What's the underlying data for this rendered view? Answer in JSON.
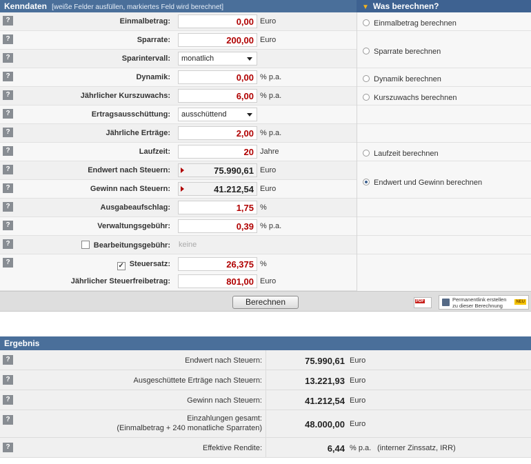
{
  "header": {
    "title": "Kenndaten",
    "subtitle": "[weiße Felder ausfüllen, markiertes Feld wird berechnet]",
    "right_title": "Was berechnen?"
  },
  "help_label": "?",
  "fields": {
    "einmalbetrag": {
      "label": "Einmalbetrag:",
      "value": "0,00",
      "unit": "Euro"
    },
    "sparrate": {
      "label": "Sparrate:",
      "value": "200,00",
      "unit": "Euro"
    },
    "sparintervall": {
      "label": "Sparintervall:",
      "value": "monatlich"
    },
    "dynamik": {
      "label": "Dynamik:",
      "value": "0,00",
      "unit": "% p.a."
    },
    "kurszuwachs": {
      "label": "Jährlicher Kurszuwachs:",
      "value": "6,00",
      "unit": "% p.a."
    },
    "ausschuettung": {
      "label": "Ertragsausschüttung:",
      "value": "ausschüttend"
    },
    "ertraege": {
      "label": "Jährliche Erträge:",
      "value": "2,00",
      "unit": "% p.a."
    },
    "laufzeit": {
      "label": "Laufzeit:",
      "value": "20",
      "unit": "Jahre"
    },
    "endwert": {
      "label": "Endwert nach Steuern:",
      "value": "75.990,61",
      "unit": "Euro"
    },
    "gewinn": {
      "label": "Gewinn nach Steuern:",
      "value": "41.212,54",
      "unit": "Euro"
    },
    "ausgabeaufschlag": {
      "label": "Ausgabeaufschlag:",
      "value": "1,75",
      "unit": "%"
    },
    "verwaltung": {
      "label": "Verwaltungsgebühr:",
      "value": "0,39",
      "unit": "% p.a."
    },
    "bearbeitung": {
      "label": "Bearbeitungsgebühr:",
      "value": "keine",
      "checked": false
    },
    "steuersatz": {
      "label": "Steuersatz:",
      "value": "26,375",
      "unit": "%",
      "checked": true
    },
    "freibetrag": {
      "label": "Jährlicher Steuerfreibetrag:",
      "value": "801,00",
      "unit": "Euro"
    }
  },
  "options": {
    "einmalbetrag": "Einmalbetrag berechnen",
    "sparrate": "Sparrate berechnen",
    "dynamik": "Dynamik berechnen",
    "kurszuwachs": "Kurszuwachs berechnen",
    "laufzeit": "Laufzeit berechnen",
    "endwert": "Endwert und Gewinn berechnen",
    "selected": "endwert"
  },
  "actions": {
    "calculate": "Berechnen",
    "pdf": "PDF",
    "permalink_line1": "Permanentlink erstellen",
    "permalink_line2": "zu dieser Berechnung",
    "new_badge": "NEU"
  },
  "result": {
    "title": "Ergebnis",
    "rows": [
      {
        "label": "Endwert nach Steuern:",
        "value": "75.990,61",
        "unit": "Euro"
      },
      {
        "label": "Ausgeschüttete Erträge nach Steuern:",
        "value": "13.221,93",
        "unit": "Euro"
      },
      {
        "label": "Gewinn nach Steuern:",
        "value": "41.212,54",
        "unit": "Euro"
      },
      {
        "label": "Einzahlungen gesamt:",
        "sublabel": "(Einmalbetrag + 240 monatliche Sparraten)",
        "value": "48.000,00",
        "unit": "Euro"
      },
      {
        "label": "Effektive Rendite:",
        "value": "6,44",
        "unit": "% p.a.",
        "note": "(interner Zinssatz, IRR)"
      }
    ]
  },
  "colors": {
    "header": "#4a6f9a",
    "input_value": "#b00000",
    "accent": "#f5b31c"
  }
}
